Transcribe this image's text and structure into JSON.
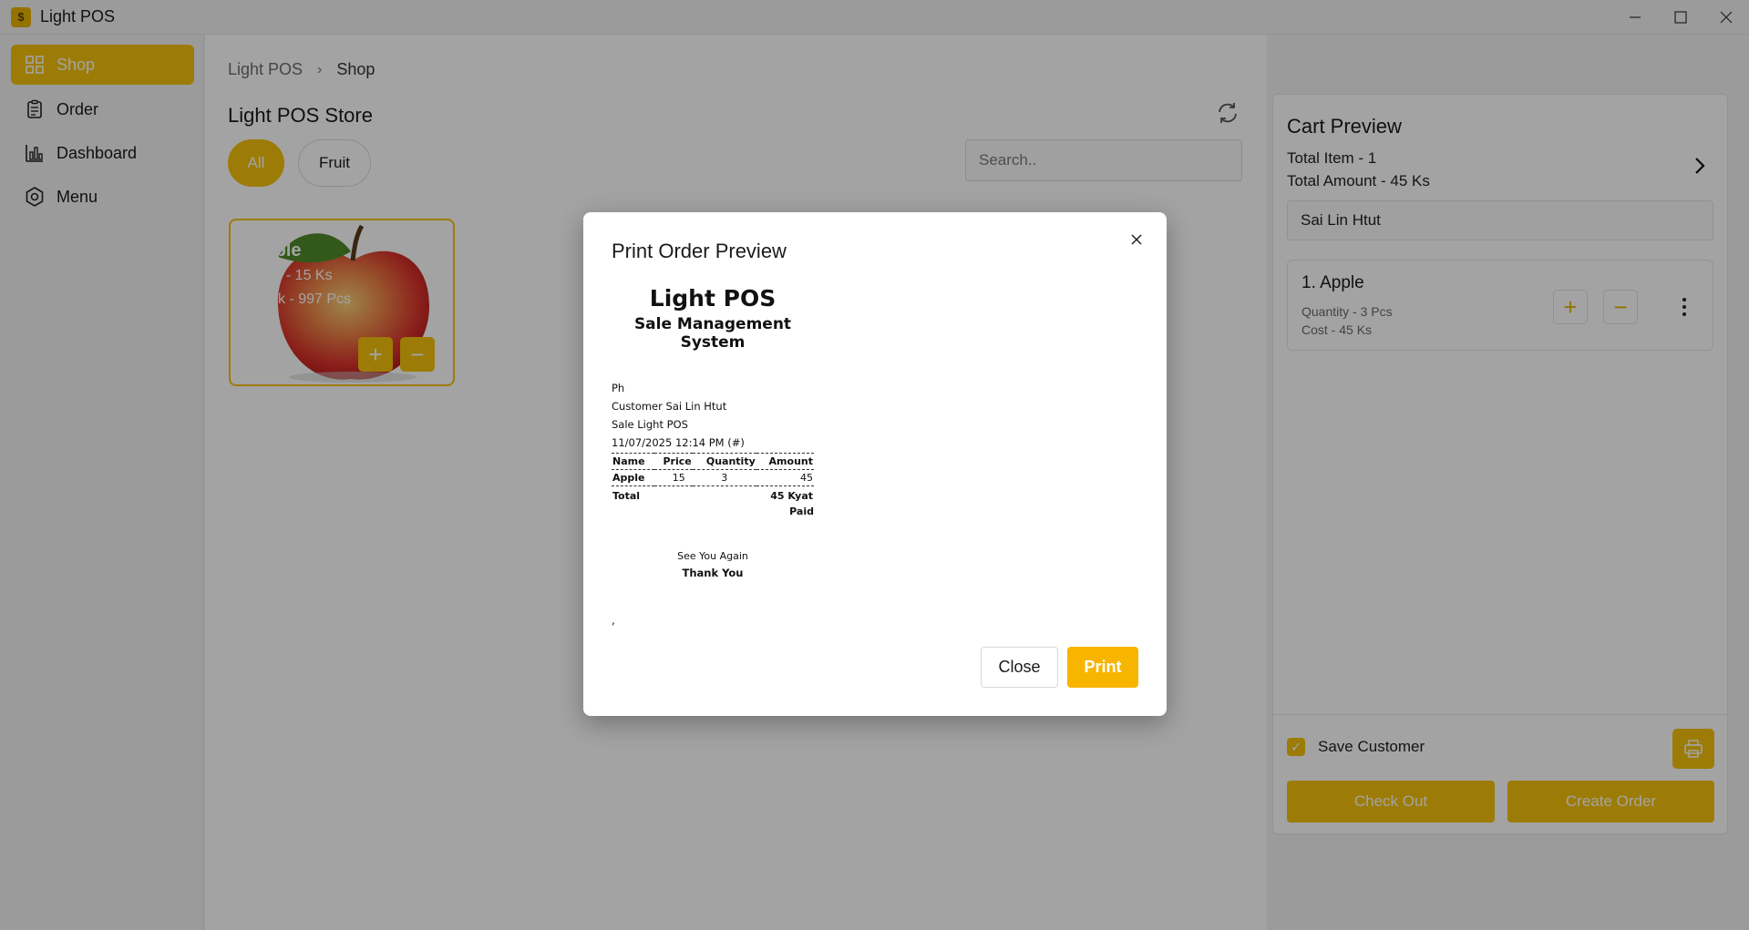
{
  "window": {
    "title": "Light POS",
    "logo_glyph": "$"
  },
  "sidebar": {
    "items": [
      {
        "label": "Shop",
        "icon": "grid-icon",
        "active": true
      },
      {
        "label": "Order",
        "icon": "clipboard-icon",
        "active": false
      },
      {
        "label": "Dashboard",
        "icon": "bar-chart-icon",
        "active": false
      },
      {
        "label": "Menu",
        "icon": "gear-icon",
        "active": false
      }
    ]
  },
  "main": {
    "breadcrumb": [
      "Light POS",
      "Shop"
    ],
    "store_title": "Light POS Store",
    "categories": [
      "All",
      "Fruit"
    ],
    "search": {
      "placeholder": "Search..",
      "value": ""
    },
    "products": [
      {
        "name": "Apple",
        "price": "Price - 15 Ks",
        "stock": "Stock - 997 Pcs"
      }
    ]
  },
  "cart": {
    "title": "Cart Preview",
    "total_item": "Total Item - 1",
    "total_amount": "Total Amount - 45 Ks",
    "customer": "Sai Lin Htut",
    "items": [
      {
        "name": "1. Apple",
        "quantity": "Quantity - 3 Pcs",
        "cost": "Cost - 45 Ks"
      }
    ],
    "save_customer_label": "Save Customer",
    "save_customer_checked": true,
    "checkout_label": "Check Out",
    "create_order_label": "Create Order"
  },
  "modal": {
    "title": "Print Order Preview",
    "receipt": {
      "shop_name": "Light POS",
      "subtitle": "Sale Management System",
      "phone": "Ph",
      "customer": "Customer Sai Lin Htut",
      "sale": "Sale Light POS",
      "datetime": "11/07/2025 12:14 PM (#)",
      "columns": [
        "Name",
        "Price",
        "Quantity",
        "Amount"
      ],
      "rows": [
        {
          "name": "Apple",
          "price": "15",
          "quantity": "3",
          "amount": "45"
        }
      ],
      "total_label": "Total",
      "total_value": "45 Kyat",
      "paid": "Paid",
      "see_you": "See You Again",
      "thank_you": "Thank You",
      "footer": ","
    },
    "close_label": "Close",
    "print_label": "Print"
  },
  "colors": {
    "accent": "#f5c20c",
    "print_button": "#f7b500",
    "overlay": "rgba(0,0,0,0.36)"
  }
}
